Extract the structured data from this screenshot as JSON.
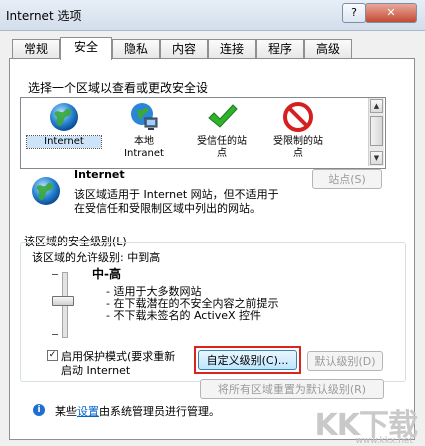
{
  "window": {
    "title": "Internet 选项",
    "help": "?",
    "close": "✕"
  },
  "tabs": [
    "常规",
    "安全",
    "隐私",
    "内容",
    "连接",
    "程序",
    "高级"
  ],
  "active_tab": "安全",
  "zone_prompt": "选择一个区域以查看或更改安全设",
  "zones": [
    {
      "label": "Internet",
      "icon": "globe-icon"
    },
    {
      "label": "本地\nIntranet",
      "icon": "local-intranet-icon"
    },
    {
      "label": "受信任的站\n点",
      "icon": "trusted-sites-check-icon"
    },
    {
      "label": "受限制的站\n点",
      "icon": "restricted-sites-icon"
    }
  ],
  "zone_detail": {
    "name": "Internet",
    "desc_line1": "该区域适用于 Internet 网站，但不适用于",
    "desc_line2": "在受信任和受限制区域中列出的网站。",
    "sites_button": "站点(S)"
  },
  "security_level": {
    "group_title": "该区域的安全级别(L)",
    "allowed_levels": "该区域的允许级别: 中到高",
    "level_name": "中-高",
    "bullet1": "- 适用于大多数网站",
    "bullet2": "- 在下载潜在的不安全内容之前提示",
    "bullet3": "- 不下载未签名的 ActiveX 控件",
    "protected_mode_line1": "启用保护模式(要求重新",
    "protected_mode_line2": "启动 Internet",
    "protected_mode_checked": true,
    "custom_level_button": "自定义级别(C)...",
    "default_level_button": "默认级别(D)",
    "reset_all_button": "将所有区域重置为默认级别(R)"
  },
  "info_bar": {
    "prefix": "某些",
    "link": "设置",
    "suffix": "由系统管理员进行管理。"
  },
  "watermark": {
    "text": "KK下载",
    "url": "www.kkx.net"
  }
}
